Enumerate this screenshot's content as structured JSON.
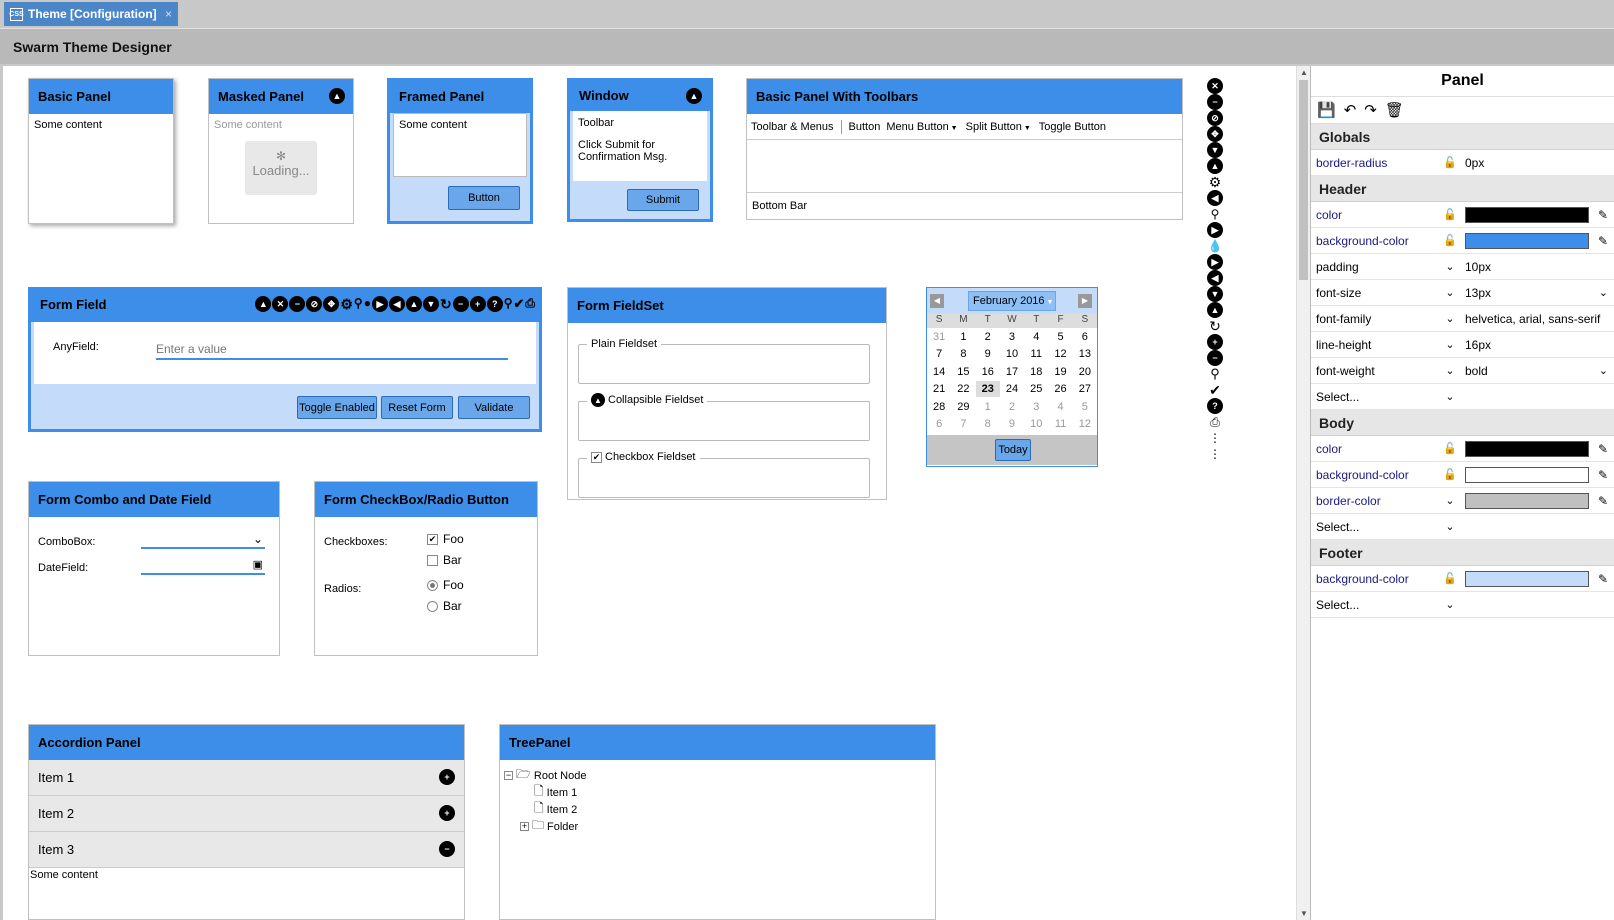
{
  "tab": {
    "title": "Theme [Configuration]",
    "close": "×"
  },
  "app": {
    "title": "Swarm Theme Designer"
  },
  "basic_panel": {
    "title": "Basic Panel",
    "content": "Some content"
  },
  "masked_panel": {
    "title": "Masked Panel",
    "content": "Some content",
    "loading": "Loading..."
  },
  "framed_panel": {
    "title": "Framed Panel",
    "content": "Some content",
    "button": "Button"
  },
  "window": {
    "title": "Window",
    "toolbar": "Toolbar",
    "message": "Click Submit for Confirmation Msg.",
    "button": "Submit"
  },
  "toolbars_panel": {
    "title": "Basic Panel With Toolbars",
    "items": [
      "Toolbar & Menus",
      "Button",
      "Menu Button",
      "Split Button",
      "Toggle Button"
    ],
    "bottom": "Bottom Bar"
  },
  "form_field": {
    "title": "Form Field",
    "label": "AnyField:",
    "placeholder": "Enter a value",
    "buttons": [
      "Toggle Enabled",
      "Reset Form",
      "Validate"
    ]
  },
  "fieldset": {
    "title": "Form FieldSet",
    "plain": "Plain Fieldset",
    "collapsible": "Collapsible Fieldset",
    "checkbox": "Checkbox Fieldset"
  },
  "calendar": {
    "month": "February 2016",
    "days": [
      "S",
      "M",
      "T",
      "W",
      "T",
      "F",
      "S"
    ],
    "weeks": [
      [
        "31",
        "1",
        "2",
        "3",
        "4",
        "5",
        "6"
      ],
      [
        "7",
        "8",
        "9",
        "10",
        "11",
        "12",
        "13"
      ],
      [
        "14",
        "15",
        "16",
        "17",
        "18",
        "19",
        "20"
      ],
      [
        "21",
        "22",
        "23",
        "24",
        "25",
        "26",
        "27"
      ],
      [
        "28",
        "29",
        "1",
        "2",
        "3",
        "4",
        "5"
      ],
      [
        "6",
        "7",
        "8",
        "9",
        "10",
        "11",
        "12"
      ]
    ],
    "today": "Today",
    "selected": "23"
  },
  "combo_panel": {
    "title": "Form Combo and Date Field",
    "combo_label": "ComboBox:",
    "date_label": "DateField:"
  },
  "checkbox_panel": {
    "title": "Form CheckBox/Radio Button",
    "cb_label": "Checkboxes:",
    "cb": [
      "Foo",
      "Bar"
    ],
    "radio_label": "Radios:",
    "radio": [
      "Foo",
      "Bar"
    ]
  },
  "accordion": {
    "title": "Accordion Panel",
    "items": [
      "Item 1",
      "Item 2",
      "Item 3"
    ],
    "content": "Some content"
  },
  "tree": {
    "title": "TreePanel",
    "root": "Root Node",
    "items": [
      "Item 1",
      "Item 2"
    ],
    "folder": "Folder"
  },
  "glyph_icons": [
    "close-circle-icon",
    "minus-circle-icon",
    "ban-circle-icon",
    "arrows-move-icon",
    "chevron-down-circle-icon",
    "gear-icon",
    "chevron-left-circle-icon",
    "pin-icon",
    "chevron-right-circle-icon",
    "drop-icon",
    "chevron-right-circle-icon",
    "chevron-left-circle-icon",
    "chevron-down-circle-icon",
    "chevron-up-circle-icon",
    "refresh-icon",
    "plus-circle-icon",
    "minus-circle-icon",
    "search-icon",
    "check-icon",
    "question-icon",
    "print-icon",
    "tree-icon"
  ],
  "props": {
    "title": "Panel",
    "sections": [
      {
        "name": "Globals",
        "rows": [
          {
            "name": "border-radius",
            "value": "0px",
            "kind": "lock"
          }
        ]
      },
      {
        "name": "Header",
        "rows": [
          {
            "name": "color",
            "kind": "color",
            "color": "#000000"
          },
          {
            "name": "background-color",
            "kind": "color",
            "color": "#3d8ee8"
          },
          {
            "name": "padding",
            "kind": "select",
            "value": "10px"
          },
          {
            "name": "font-size",
            "kind": "select",
            "value": "13px"
          },
          {
            "name": "font-family",
            "kind": "select",
            "value": "helvetica, arial, sans-serif"
          },
          {
            "name": "line-height",
            "kind": "select",
            "value": "16px"
          },
          {
            "name": "font-weight",
            "kind": "select",
            "value": "bold"
          },
          {
            "name": "Select...",
            "kind": "select",
            "value": ""
          }
        ]
      },
      {
        "name": "Body",
        "rows": [
          {
            "name": "color",
            "kind": "color",
            "color": "#000000"
          },
          {
            "name": "background-color",
            "kind": "color",
            "color": "#ffffff"
          },
          {
            "name": "border-color",
            "kind": "colorsel",
            "color": "#c0c0c0"
          },
          {
            "name": "Select...",
            "kind": "select",
            "value": ""
          }
        ]
      },
      {
        "name": "Footer",
        "rows": [
          {
            "name": "background-color",
            "kind": "color",
            "color": "#c5dbfa"
          },
          {
            "name": "Select...",
            "kind": "select",
            "value": ""
          }
        ]
      }
    ]
  }
}
